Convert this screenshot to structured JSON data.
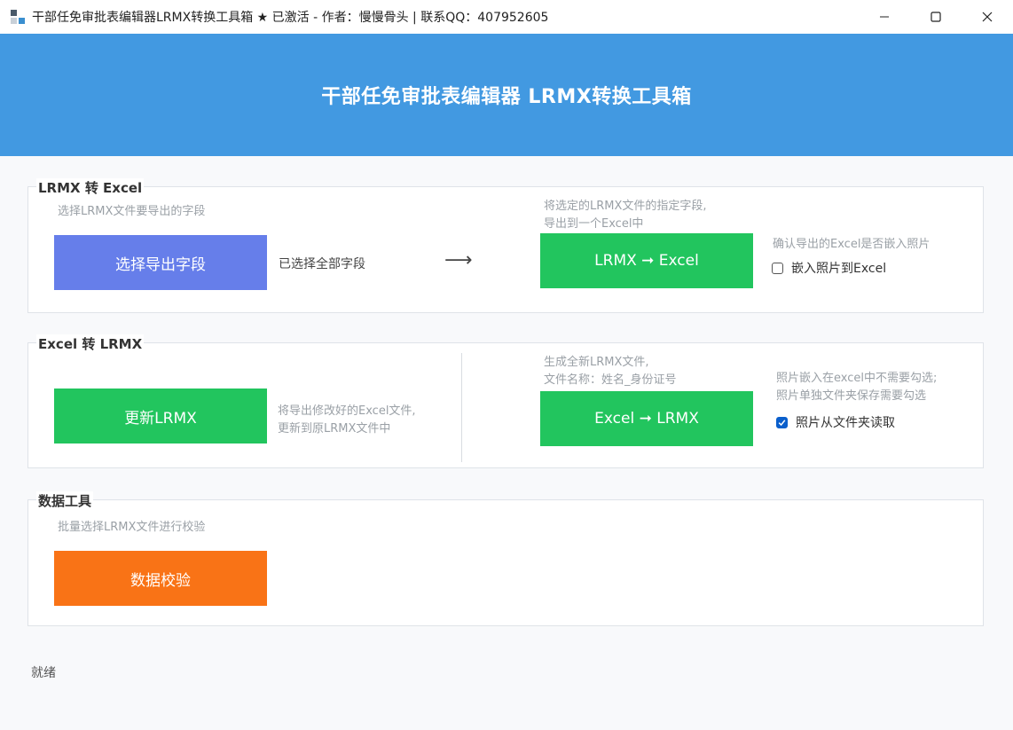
{
  "window": {
    "title": "干部任免审批表编辑器LRMX转换工具箱 ★ 已激活 - 作者：慢慢骨头 | 联系QQ：407952605"
  },
  "header": {
    "title": "干部任免审批表编辑器 LRMX转换工具箱"
  },
  "lrmx_to_excel": {
    "title": "LRMX 转 Excel",
    "select_hint": "选择LRMX文件要导出的字段",
    "select_button": "选择导出字段",
    "selected_status": "已选择全部字段",
    "arrow": "⟶",
    "export_hint_line1": "将选定的LRMX文件的指定字段,",
    "export_hint_line2": "导出到一个Excel中",
    "export_button": "LRMX ➞ Excel",
    "photo_hint": "确认导出的Excel是否嵌入照片",
    "embed_photo_label": "嵌入照片到Excel",
    "embed_photo_checked": false
  },
  "excel_to_lrmx": {
    "title": "Excel 转 LRMX",
    "update_button": "更新LRMX",
    "update_hint_line1": "将导出修改好的Excel文件,",
    "update_hint_line2": "更新到原LRMX文件中",
    "generate_hint_line1": "生成全新LRMX文件,",
    "generate_hint_line2": "文件名称：姓名_身份证号",
    "generate_button": "Excel ➞ LRMX",
    "photo_hint_line1": "照片嵌入在excel中不需要勾选;",
    "photo_hint_line2": "照片单独文件夹保存需要勾选",
    "read_photo_label": "照片从文件夹读取",
    "read_photo_checked": true
  },
  "data_tools": {
    "title": "数据工具",
    "validate_hint": "批量选择LRMX文件进行校验",
    "validate_button": "数据校验"
  },
  "status_bar": {
    "text": "就绪"
  },
  "colors": {
    "header": "#4299e1",
    "purple_button": "#667eea",
    "green_button": "#22c55e",
    "orange_button": "#f97316",
    "checkbox_checked": "#0a5fcc"
  }
}
